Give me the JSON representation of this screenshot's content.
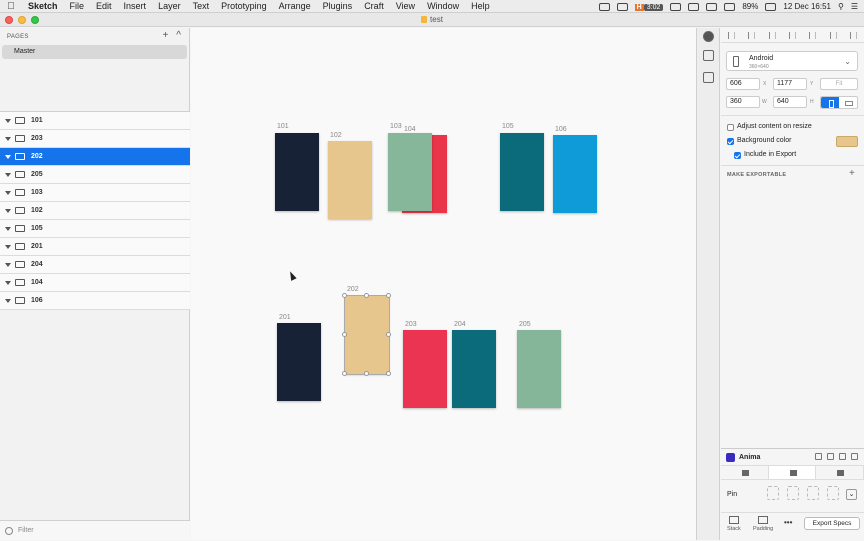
{
  "menubar": {
    "app": "Sketch",
    "items": [
      "File",
      "Edit",
      "Insert",
      "Layer",
      "Text",
      "Prototyping",
      "Arrange",
      "Plugins",
      "Craft",
      "View",
      "Window",
      "Help"
    ],
    "status": {
      "timer": "3:02",
      "timer_badge": "H",
      "battery": "89%",
      "datetime": "12 Dec 16:51"
    }
  },
  "window": {
    "title": "test"
  },
  "pages": {
    "header": "PAGES",
    "add": "+",
    "collapse": "^",
    "items": [
      "Master"
    ]
  },
  "layers": [
    "101",
    "203",
    "202",
    "205",
    "103",
    "102",
    "105",
    "201",
    "204",
    "104",
    "106"
  ],
  "selected_layer": "202",
  "filter": {
    "placeholder": "Filter"
  },
  "artboards": [
    {
      "label": "101",
      "color": "#172237"
    },
    {
      "label": "102",
      "color": "#e7c68e"
    },
    {
      "label": "103",
      "color": "#87b79b"
    },
    {
      "label": "104",
      "color": "#e93449"
    },
    {
      "label": "105",
      "color": "#0c6b7a"
    },
    {
      "label": "106",
      "color": "#0f9ad8"
    },
    {
      "label": "201",
      "color": "#172237"
    },
    {
      "label": "202",
      "color": "#e7c68e"
    },
    {
      "label": "203",
      "color": "#ea3451"
    },
    {
      "label": "204",
      "color": "#0c6b7a"
    },
    {
      "label": "205",
      "color": "#86b69a"
    }
  ],
  "inspector": {
    "device": {
      "name": "Android",
      "size": "360×640"
    },
    "x": "606",
    "x_label": "X",
    "y": "1177",
    "y_label": "Y",
    "fit": "Fit",
    "w": "360",
    "w_label": "W",
    "h": "640",
    "h_label": "H",
    "adjust_content": "Adjust content on resize",
    "background_color": "Background color",
    "background_swatch": "#e7c68e",
    "include_export": "Include in Export",
    "make_exportable": "MAKE EXPORTABLE",
    "add": "+"
  },
  "anima": {
    "title": "Anima",
    "pin": "Pin",
    "pin_dropdown": "⌄",
    "stack": "Stack",
    "padding": "Padding",
    "more": "•••",
    "export_specs": "Export Specs"
  },
  "colors": {
    "selection": "#1574eb"
  }
}
